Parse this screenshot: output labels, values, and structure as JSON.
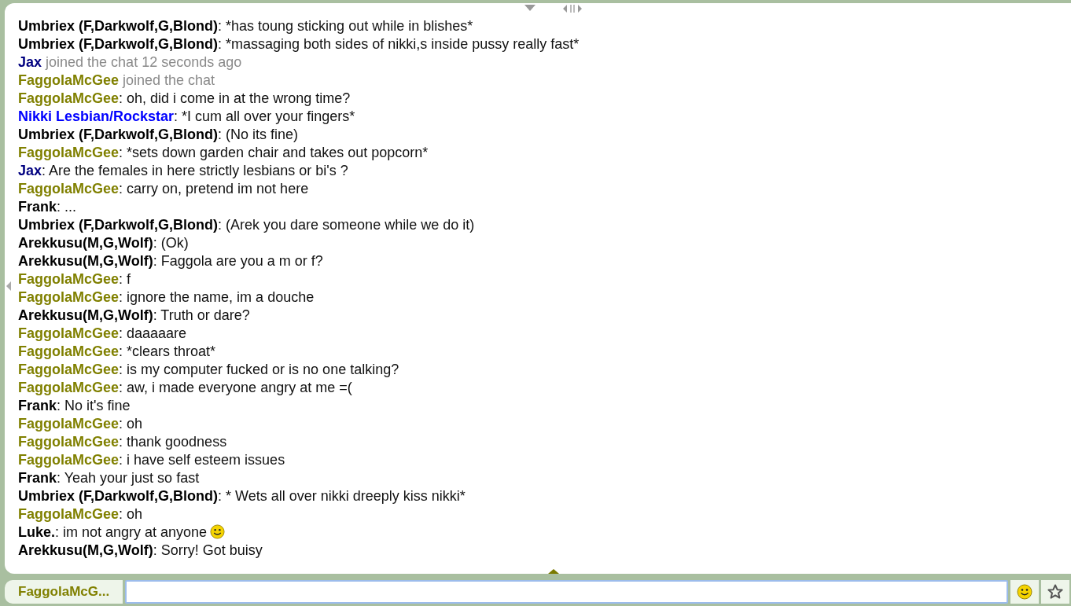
{
  "messages": [
    {
      "kind": "message",
      "name": "Umbriex (F,Darkwolf,G,Blond)",
      "color": "#000000",
      "text": ": *has toung sticking out while in blishes*"
    },
    {
      "kind": "message",
      "name": "Umbriex (F,Darkwolf,G,Blond)",
      "color": "#000000",
      "text": ": *massaging both sides of nikki,s inside pussy really fast*"
    },
    {
      "kind": "join",
      "name": "Jax",
      "color": "#000080",
      "text": "joined the chat 12 seconds ago"
    },
    {
      "kind": "join",
      "name": "FaggolaMcGee",
      "color": "#808000",
      "text": "joined the chat"
    },
    {
      "kind": "message",
      "name": "FaggolaMcGee",
      "color": "#808000",
      "text": ": oh, did i come in at the wrong time?"
    },
    {
      "kind": "message",
      "name": "Nikki Lesbian/Rockstar",
      "color": "#0000ff",
      "text": ": *I cum all over your fingers*"
    },
    {
      "kind": "message",
      "name": "Umbriex (F,Darkwolf,G,Blond)",
      "color": "#000000",
      "text": ": (No its fine)"
    },
    {
      "kind": "message",
      "name": "FaggolaMcGee",
      "color": "#808000",
      "text": ": *sets down garden chair and takes out popcorn*"
    },
    {
      "kind": "message",
      "name": "Jax",
      "color": "#000080",
      "text": ": Are the females in here strictly lesbians or bi's ?"
    },
    {
      "kind": "message",
      "name": "FaggolaMcGee",
      "color": "#808000",
      "text": ": carry on, pretend im not here"
    },
    {
      "kind": "message",
      "name": "Frank",
      "color": "#000000",
      "text": ": ..."
    },
    {
      "kind": "message",
      "name": "Umbriex (F,Darkwolf,G,Blond)",
      "color": "#000000",
      "text": ": (Arek you dare someone while we do it)"
    },
    {
      "kind": "message",
      "name": "Arekkusu(M,G,Wolf)",
      "color": "#000000",
      "text": ": (Ok)"
    },
    {
      "kind": "message",
      "name": "Arekkusu(M,G,Wolf)",
      "color": "#000000",
      "text": ": Faggola are you a m or f?"
    },
    {
      "kind": "message",
      "name": "FaggolaMcGee",
      "color": "#808000",
      "text": ": f"
    },
    {
      "kind": "message",
      "name": "FaggolaMcGee",
      "color": "#808000",
      "text": ": ignore the name, im a douche"
    },
    {
      "kind": "message",
      "name": "Arekkusu(M,G,Wolf)",
      "color": "#000000",
      "text": ": Truth or dare?"
    },
    {
      "kind": "message",
      "name": "FaggolaMcGee",
      "color": "#808000",
      "text": ": daaaaare"
    },
    {
      "kind": "message",
      "name": "FaggolaMcGee",
      "color": "#808000",
      "text": ": *clears throat*"
    },
    {
      "kind": "message",
      "name": "FaggolaMcGee",
      "color": "#808000",
      "text": ": is my computer fucked or is no one talking?"
    },
    {
      "kind": "message",
      "name": "FaggolaMcGee",
      "color": "#808000",
      "text": ": aw, i made everyone angry at me =("
    },
    {
      "kind": "message",
      "name": "Frank",
      "color": "#000000",
      "text": ": No it's fine"
    },
    {
      "kind": "message",
      "name": "FaggolaMcGee",
      "color": "#808000",
      "text": ": oh"
    },
    {
      "kind": "message",
      "name": "FaggolaMcGee",
      "color": "#808000",
      "text": ": thank goodness"
    },
    {
      "kind": "message",
      "name": "FaggolaMcGee",
      "color": "#808000",
      "text": ": i have self esteem issues"
    },
    {
      "kind": "message",
      "name": "Frank",
      "color": "#000000",
      "text": ": Yeah your just so fast"
    },
    {
      "kind": "message",
      "name": "Umbriex (F,Darkwolf,G,Blond)",
      "color": "#000000",
      "text": ": * Wets all over nikki dreeply kiss nikki*"
    },
    {
      "kind": "message",
      "name": "FaggolaMcGee",
      "color": "#808000",
      "text": ": oh"
    },
    {
      "kind": "message",
      "name": "Luke.",
      "color": "#000000",
      "text": ": im not angry at anyone",
      "emoticon": true
    },
    {
      "kind": "message",
      "name": "Arekkusu(M,G,Wolf)",
      "color": "#000000",
      "text": ": Sorry! Got buisy"
    }
  ],
  "composer": {
    "nickname": "FaggolaMcG..."
  }
}
